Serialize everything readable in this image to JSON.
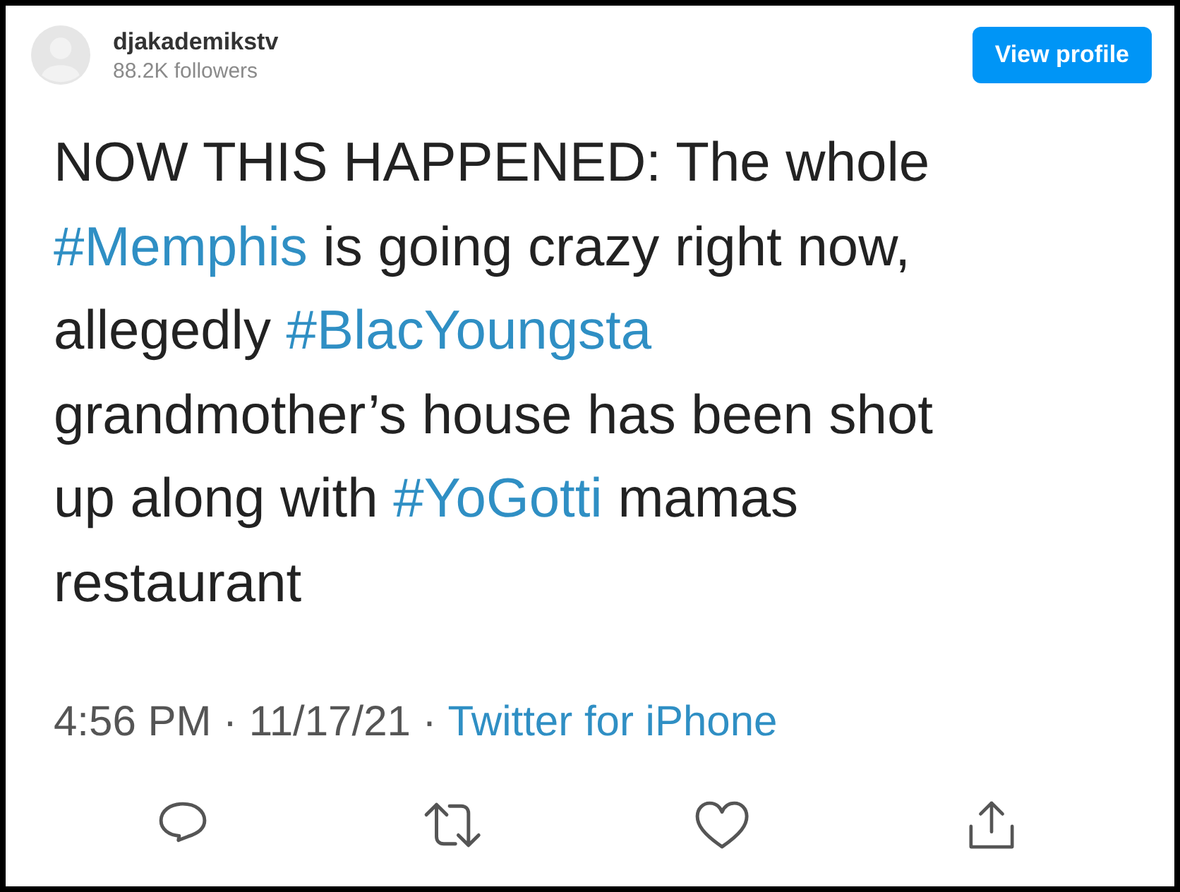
{
  "header": {
    "username": "djakademikstv",
    "followers": "88.2K followers",
    "button": "View profile"
  },
  "tweet": {
    "segments": [
      {
        "kind": "text",
        "text": "NOW THIS HAPPENED: The whole"
      },
      {
        "kind": "break"
      },
      {
        "kind": "hashtag",
        "text": "#Memphis"
      },
      {
        "kind": "text",
        "text": " is going crazy right now,"
      },
      {
        "kind": "break"
      },
      {
        "kind": "text",
        "text": "allegedly "
      },
      {
        "kind": "hashtag",
        "text": "#BlacYoungsta"
      },
      {
        "kind": "break"
      },
      {
        "kind": "text",
        "text": "grandmother’s house has been shot"
      },
      {
        "kind": "break"
      },
      {
        "kind": "text",
        "text": "up along with "
      },
      {
        "kind": "hashtag",
        "text": "#YoGotti"
      },
      {
        "kind": "text",
        "text": " mamas"
      },
      {
        "kind": "break"
      },
      {
        "kind": "text",
        "text": "restaurant"
      }
    ]
  },
  "meta": {
    "timestamp": "4:56 PM · 11/17/21 ·",
    "source": "Twitter for iPhone"
  },
  "actions": [
    {
      "kind": "reply"
    },
    {
      "kind": "retweet"
    },
    {
      "kind": "like"
    },
    {
      "kind": "share"
    }
  ]
}
